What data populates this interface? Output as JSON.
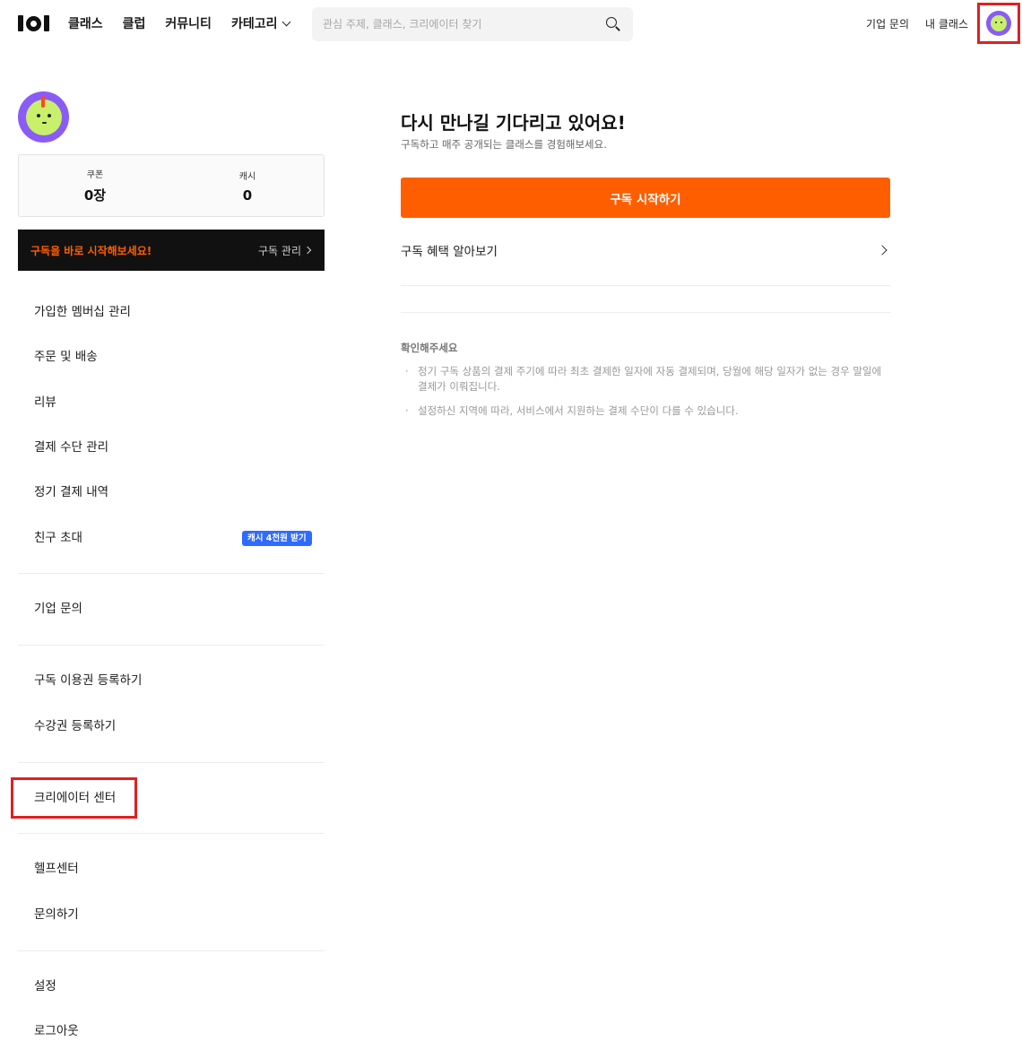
{
  "header": {
    "nav": [
      "클래스",
      "클럽",
      "커뮤니티",
      "카테고리"
    ],
    "search_placeholder": "관심 주제, 클래스, 크리에이터 찾기",
    "links": [
      "기업 문의",
      "내 클래스"
    ]
  },
  "sidebar": {
    "wallet": {
      "coupon_label": "쿠폰",
      "coupon_value": "0장",
      "cash_label": "캐시",
      "cash_value": "0"
    },
    "promo": {
      "text": "구독을 바로 시작해보세요!",
      "link": "구독 관리"
    },
    "menu": {
      "membership": "가입한 멤버십 관리",
      "orders": "주문 및 배송",
      "reviews": "리뷰",
      "payment_methods": "결제 수단 관리",
      "recurring": "정기 결제 내역",
      "invite": "친구 초대",
      "invite_badge": "캐시 4천원 받기",
      "business": "기업 문의",
      "sub_register": "구독 이용권 등록하기",
      "course_register": "수강권 등록하기",
      "creator_center": "크리에이터 센터",
      "help_center": "헬프센터",
      "contact": "문의하기",
      "settings": "설정",
      "logout": "로그아웃"
    }
  },
  "main": {
    "title": "다시 만나길 기다리고 있어요!",
    "subtitle": "구독하고 매주 공개되는 클래스를 경험해보세요.",
    "cta": "구독 시작하기",
    "benefits": "구독 혜택 알아보기",
    "notice_title": "확인해주세요",
    "notices": [
      "정기 구독 상품의 결제 주기에 따라 최초 결제한 일자에 자동 결제되며, 당월에 해당 일자가 없는 경우 말일에 결제가 이뤄집니다.",
      "설정하신 지역에 따라, 서비스에서 지원하는 결제 수단이 다를 수 있습니다."
    ]
  },
  "colors": {
    "accent": "#ff5e00",
    "badge": "#2f6bff",
    "highlight": "#e02020",
    "avatar_bg": "#8a5cf6",
    "avatar_face": "#c8f06a"
  },
  "icons": [
    "logo",
    "chevron-down-icon",
    "search-icon",
    "avatar",
    "chevron-right-icon"
  ]
}
